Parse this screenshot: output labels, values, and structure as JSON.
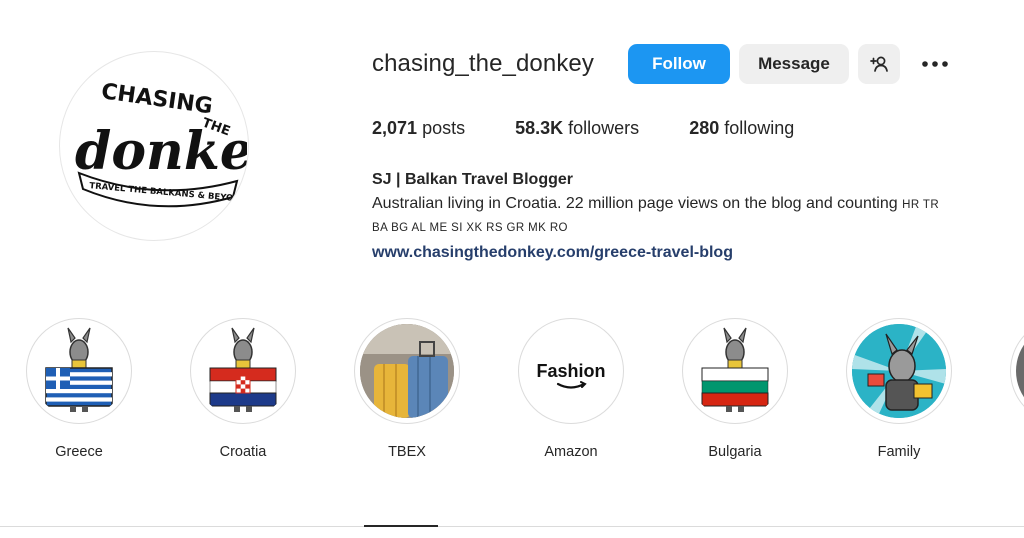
{
  "profile": {
    "username": "chasing_the_donkey",
    "avatar_alt_lines": [
      "CHASING",
      "THE",
      "donkey",
      "TRAVEL THE BALKANS & BEYOND"
    ]
  },
  "actions": {
    "follow_label": "Follow",
    "message_label": "Message",
    "suggest_icon": "person-add-icon",
    "more_icon": "more-options-icon"
  },
  "stats": {
    "posts_count": "2,071",
    "posts_label": "posts",
    "followers_count": "58.3K",
    "followers_label": "followers",
    "following_count": "280",
    "following_label": "following"
  },
  "bio": {
    "name": "SJ | Balkan Travel Blogger",
    "line1": "Australian living in Croatia. 22 million page views on the blog and counting",
    "codes1": "HR TR",
    "codes2": "BA BG AL ME SI XK RS GR MK RO",
    "link": "www.chasingthedonkey.com/greece-travel-blog"
  },
  "highlights": [
    {
      "label": "Greece",
      "icon": "greece-flag-donkey-icon"
    },
    {
      "label": "Croatia",
      "icon": "croatia-flag-donkey-icon"
    },
    {
      "label": "TBEX",
      "icon": "luggage-photo"
    },
    {
      "label": "Amazon",
      "icon": "amazon-fashion-logo",
      "logo_text": "Fashion"
    },
    {
      "label": "Bulgaria",
      "icon": "bulgaria-flag-donkey-icon"
    },
    {
      "label": "Family",
      "icon": "donkey-family-icon"
    }
  ],
  "colors": {
    "follow_bg": "#1c96f2",
    "secondary_bg": "#efefef",
    "link": "#263e6b",
    "text": "#262626"
  }
}
